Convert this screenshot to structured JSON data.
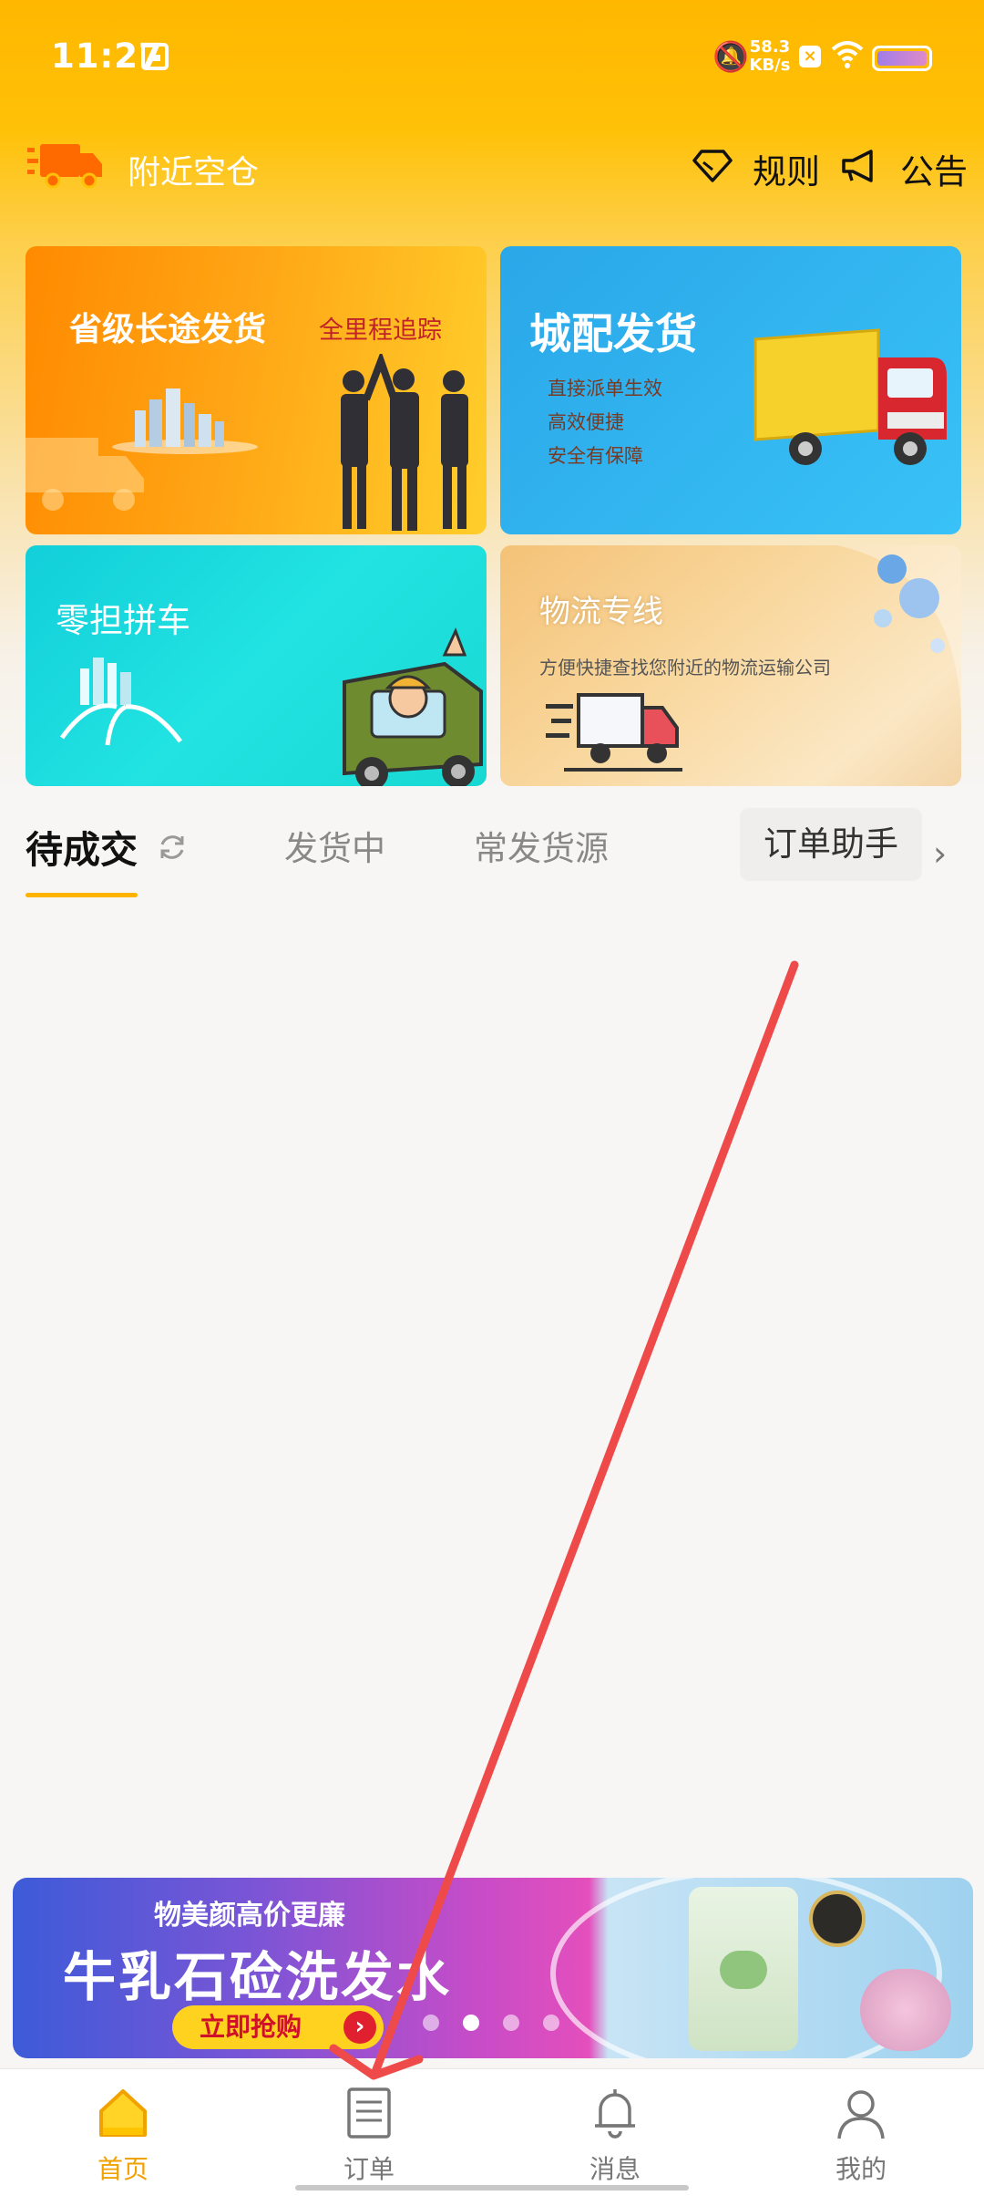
{
  "status_bar": {
    "time": "11:27",
    "net_speed_value": "58.3",
    "net_speed_unit": "KB/s",
    "icons": [
      "calendar-icon",
      "mute-bell-icon",
      "close-box-icon",
      "wifi-icon",
      "battery-icon"
    ]
  },
  "topbar": {
    "brand": "附近空仓",
    "rules_label": "规则",
    "notice_label": "公告"
  },
  "cards": [
    {
      "title": "省级长途发货",
      "subtitle": "全里程追踪"
    },
    {
      "title": "城配发货",
      "lines": [
        "直接派单生效",
        "高效便捷",
        "安全有保障"
      ]
    },
    {
      "title": "零担拼车"
    },
    {
      "title": "物流专线",
      "desc": "方便快捷查找您附近的物流运输公司"
    }
  ],
  "tabs": {
    "items": [
      "待成交",
      "发货中",
      "常发货源"
    ],
    "active": "待成交",
    "helper": "订单助手"
  },
  "ad": {
    "line1": "物美颜高价更廉",
    "line2": "牛乳石硷洗发水",
    "cta": "立即抢购",
    "slides": 4,
    "active_slide": 2
  },
  "nav": [
    {
      "label": "首页",
      "icon": "home-icon",
      "active": true
    },
    {
      "label": "订单",
      "icon": "order-icon",
      "active": false
    },
    {
      "label": "消息",
      "icon": "bell-icon",
      "active": false
    },
    {
      "label": "我的",
      "icon": "user-icon",
      "active": false
    }
  ],
  "colors": {
    "accent": "#ffb300",
    "annotation_arrow": "#ef4a4a"
  }
}
